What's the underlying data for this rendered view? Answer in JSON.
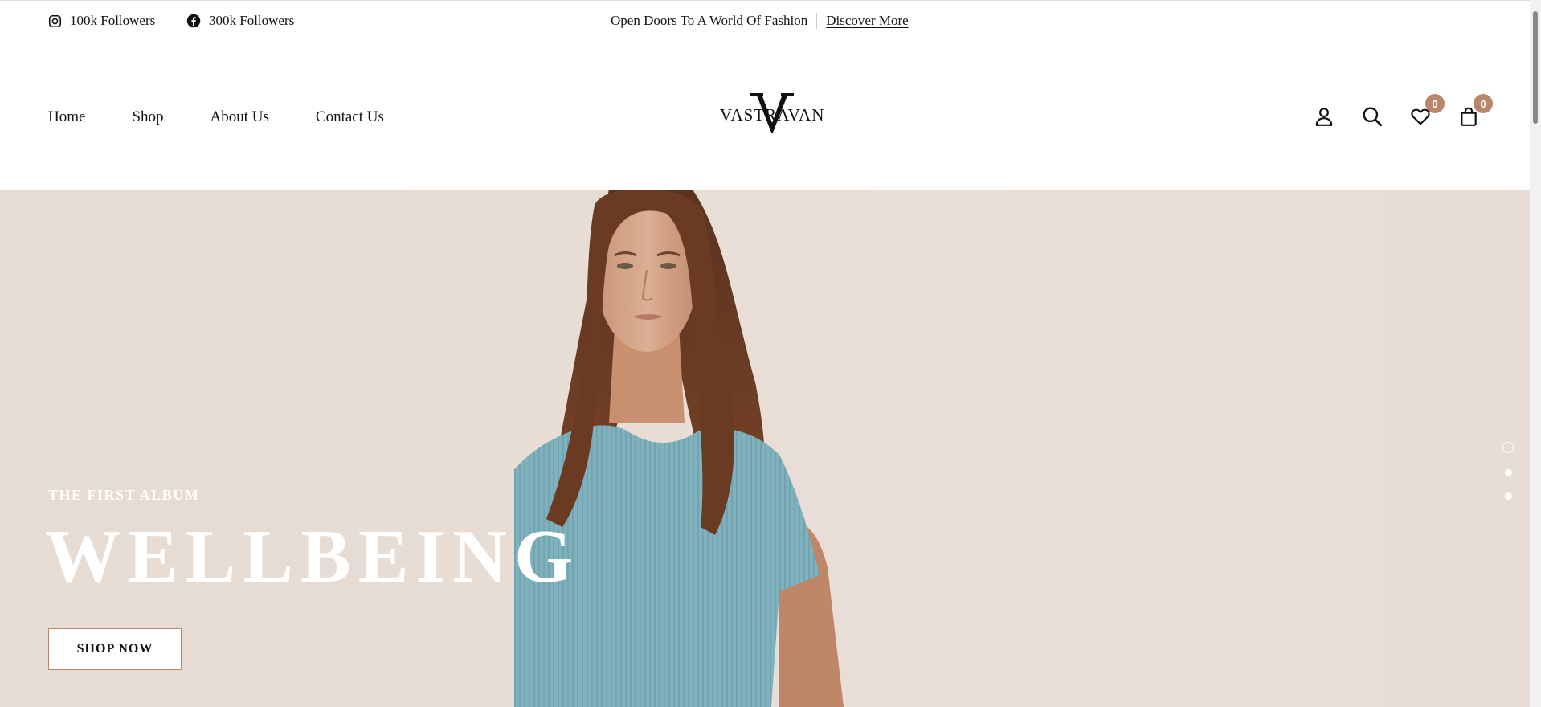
{
  "topbar": {
    "instagram": {
      "icon": "instagram-icon",
      "label": "100k Followers"
    },
    "facebook": {
      "icon": "facebook-icon",
      "label": "300k Followers"
    },
    "promo_text": "Open Doors To A World Of Fashion",
    "promo_link": "Discover More"
  },
  "nav": {
    "items": [
      {
        "label": "Home"
      },
      {
        "label": "Shop"
      },
      {
        "label": "About Us"
      },
      {
        "label": "Contact Us"
      }
    ]
  },
  "logo": {
    "mark": "V",
    "word": "VASTRAVAN"
  },
  "header_icons": {
    "account": "user-icon",
    "search": "search-icon",
    "wishlist": {
      "icon": "heart-icon",
      "count": "0"
    },
    "cart": {
      "icon": "bag-icon",
      "count": "0"
    }
  },
  "hero": {
    "kicker": "THE FIRST ALBUM",
    "title": "WELLBEING",
    "cta": "SHOP NOW",
    "slides": 3,
    "active_slide": 1
  },
  "colors": {
    "accent": "#b8866a",
    "hero_bg": "#e6dcd3",
    "shirt": "#7fb0bb"
  }
}
